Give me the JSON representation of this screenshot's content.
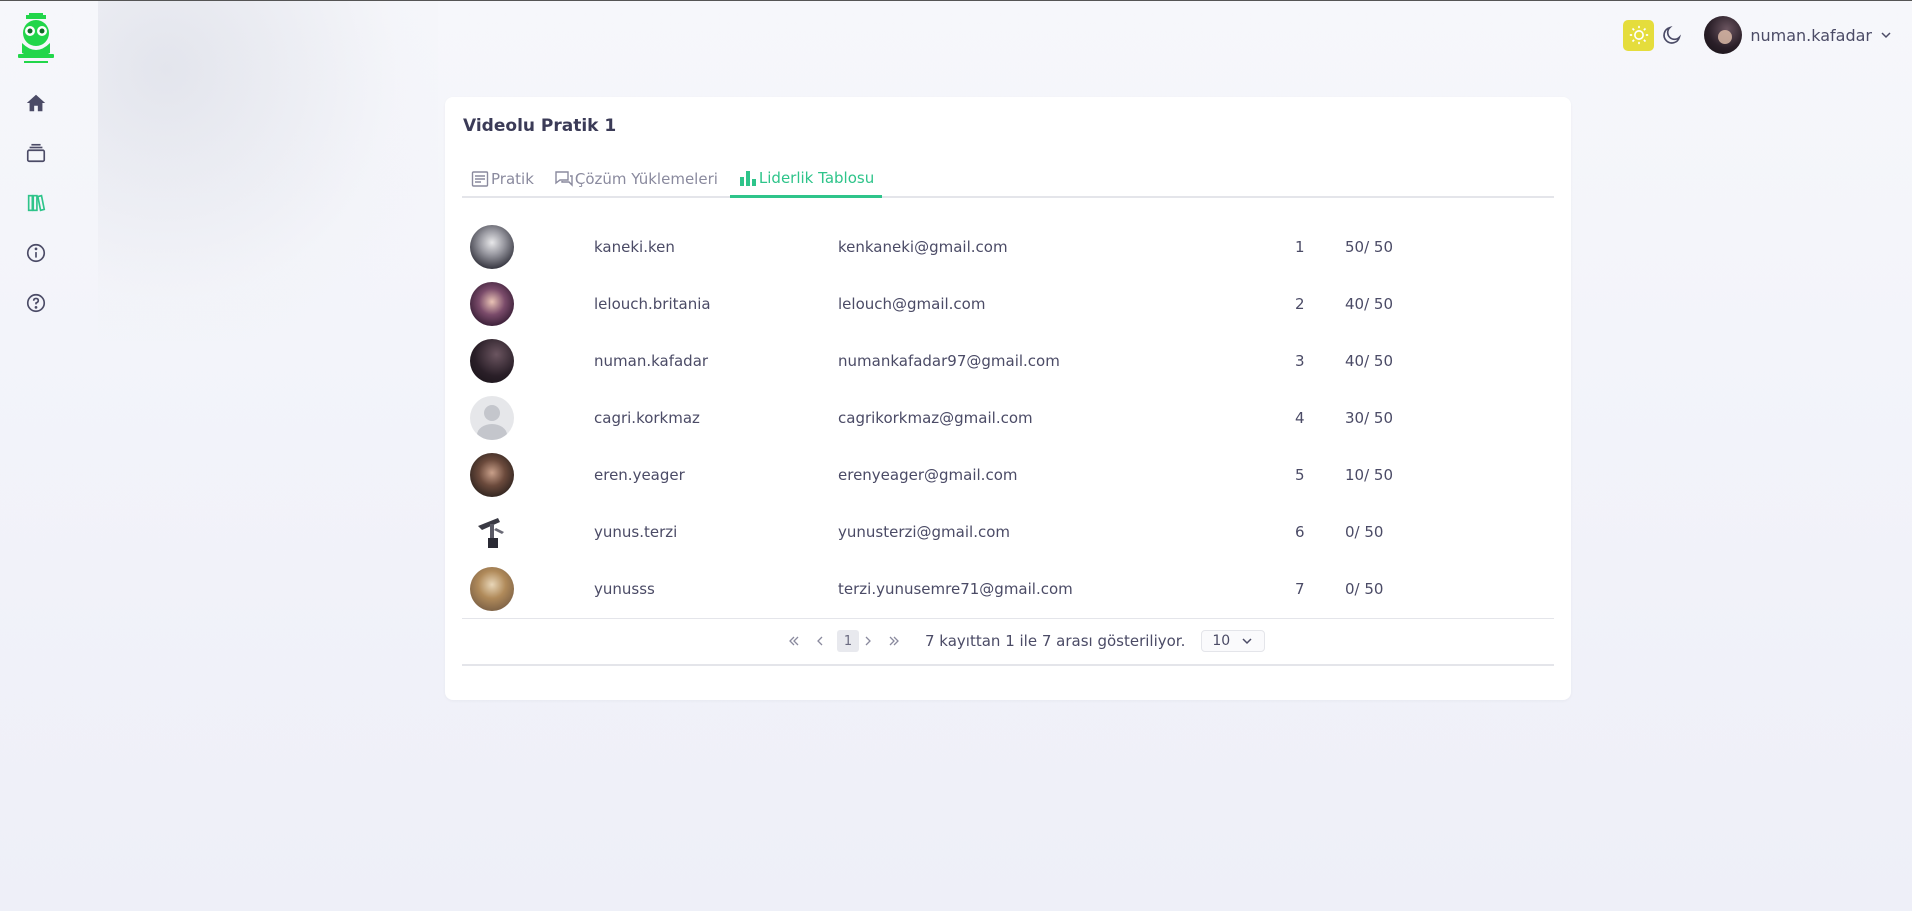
{
  "user": {
    "name": "numan.kafadar"
  },
  "sidebar": {
    "items": [
      {
        "icon": "home-icon"
      },
      {
        "icon": "courses-icon"
      },
      {
        "icon": "library-icon",
        "active": true
      },
      {
        "icon": "info-icon"
      },
      {
        "icon": "help-icon"
      }
    ]
  },
  "card": {
    "title": "Videolu Pratik 1",
    "tabs": [
      {
        "label": "Pratik",
        "icon": "document-icon"
      },
      {
        "label": "Çözüm Yüklemeleri",
        "icon": "chat-icon"
      },
      {
        "label": "Liderlik Tablosu",
        "icon": "bar-chart-icon",
        "active": true
      }
    ]
  },
  "leaderboard": [
    {
      "username": "kaneki.ken",
      "email": "kenkaneki@gmail.com",
      "rank": "1",
      "score": "50/ 50"
    },
    {
      "username": "lelouch.britania",
      "email": "lelouch@gmail.com",
      "rank": "2",
      "score": "40/ 50"
    },
    {
      "username": "numan.kafadar",
      "email": "numankafadar97@gmail.com",
      "rank": "3",
      "score": "40/ 50"
    },
    {
      "username": "cagri.korkmaz",
      "email": "cagrikorkmaz@gmail.com",
      "rank": "4",
      "score": "30/ 50"
    },
    {
      "username": "eren.yeager",
      "email": "erenyeager@gmail.com",
      "rank": "5",
      "score": "10/ 50"
    },
    {
      "username": "yunus.terzi",
      "email": "yunusterzi@gmail.com",
      "rank": "6",
      "score": "0/ 50"
    },
    {
      "username": "yunusss",
      "email": "terzi.yunusemre71@gmail.com",
      "rank": "7",
      "score": "0/ 50"
    }
  ],
  "pagination": {
    "current_page": "1",
    "summary": "7 kayıttan 1 ile 7 arası gösteriliyor.",
    "page_size": "10"
  },
  "colors": {
    "accent": "#2ec48a",
    "logo": "#22d64a",
    "theme_light_button": "#e5dd3c"
  }
}
